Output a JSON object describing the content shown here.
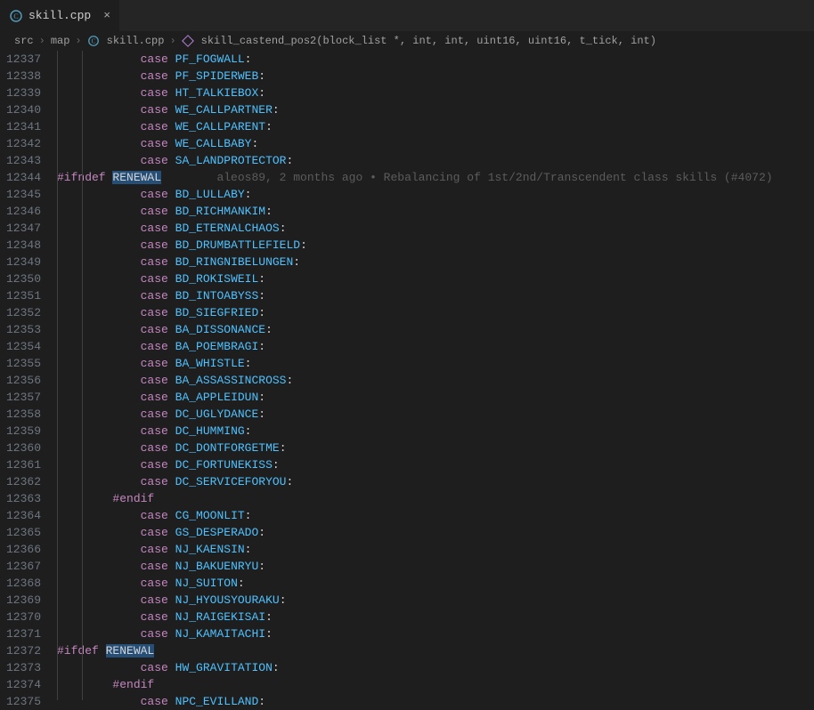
{
  "tab": {
    "filename": "skill.cpp",
    "close": "×"
  },
  "breadcrumb": {
    "seg1": "src",
    "seg2": "map",
    "seg3": "skill.cpp",
    "seg4": "skill_castend_pos2(block_list *, int, int, uint16, uint16, t_tick, int)"
  },
  "blame": {
    "author": "aleos89",
    "when": "2 months ago",
    "msg": "Rebalancing of 1st/2nd/Transcendent class skills (#4072)"
  },
  "chart_data": {
    "type": "table",
    "columns": [
      "lineNumber",
      "indent",
      "kind",
      "text",
      "highlight",
      "hasBlame"
    ],
    "rows": [
      {
        "ln": 12337,
        "indent": 3,
        "kind": "case",
        "text": "PF_FOGWALL"
      },
      {
        "ln": 12338,
        "indent": 3,
        "kind": "case",
        "text": "PF_SPIDERWEB"
      },
      {
        "ln": 12339,
        "indent": 3,
        "kind": "case",
        "text": "HT_TALKIEBOX"
      },
      {
        "ln": 12340,
        "indent": 3,
        "kind": "case",
        "text": "WE_CALLPARTNER"
      },
      {
        "ln": 12341,
        "indent": 3,
        "kind": "case",
        "text": "WE_CALLPARENT"
      },
      {
        "ln": 12342,
        "indent": 3,
        "kind": "case",
        "text": "WE_CALLBABY"
      },
      {
        "ln": 12343,
        "indent": 3,
        "kind": "case",
        "text": "SA_LANDPROTECTOR"
      },
      {
        "ln": 12344,
        "indent": 0,
        "kind": "ifndef",
        "text": "RENEWAL",
        "highlight": true,
        "hasBlame": true
      },
      {
        "ln": 12345,
        "indent": 3,
        "kind": "case",
        "text": "BD_LULLABY"
      },
      {
        "ln": 12346,
        "indent": 3,
        "kind": "case",
        "text": "BD_RICHMANKIM"
      },
      {
        "ln": 12347,
        "indent": 3,
        "kind": "case",
        "text": "BD_ETERNALCHAOS"
      },
      {
        "ln": 12348,
        "indent": 3,
        "kind": "case",
        "text": "BD_DRUMBATTLEFIELD"
      },
      {
        "ln": 12349,
        "indent": 3,
        "kind": "case",
        "text": "BD_RINGNIBELUNGEN"
      },
      {
        "ln": 12350,
        "indent": 3,
        "kind": "case",
        "text": "BD_ROKISWEIL"
      },
      {
        "ln": 12351,
        "indent": 3,
        "kind": "case",
        "text": "BD_INTOABYSS"
      },
      {
        "ln": 12352,
        "indent": 3,
        "kind": "case",
        "text": "BD_SIEGFRIED"
      },
      {
        "ln": 12353,
        "indent": 3,
        "kind": "case",
        "text": "BA_DISSONANCE"
      },
      {
        "ln": 12354,
        "indent": 3,
        "kind": "case",
        "text": "BA_POEMBRAGI"
      },
      {
        "ln": 12355,
        "indent": 3,
        "kind": "case",
        "text": "BA_WHISTLE"
      },
      {
        "ln": 12356,
        "indent": 3,
        "kind": "case",
        "text": "BA_ASSASSINCROSS"
      },
      {
        "ln": 12357,
        "indent": 3,
        "kind": "case",
        "text": "BA_APPLEIDUN"
      },
      {
        "ln": 12358,
        "indent": 3,
        "kind": "case",
        "text": "DC_UGLYDANCE"
      },
      {
        "ln": 12359,
        "indent": 3,
        "kind": "case",
        "text": "DC_HUMMING"
      },
      {
        "ln": 12360,
        "indent": 3,
        "kind": "case",
        "text": "DC_DONTFORGETME"
      },
      {
        "ln": 12361,
        "indent": 3,
        "kind": "case",
        "text": "DC_FORTUNEKISS"
      },
      {
        "ln": 12362,
        "indent": 3,
        "kind": "case",
        "text": "DC_SERVICEFORYOU"
      },
      {
        "ln": 12363,
        "indent": 2,
        "kind": "endif",
        "text": ""
      },
      {
        "ln": 12364,
        "indent": 3,
        "kind": "case",
        "text": "CG_MOONLIT"
      },
      {
        "ln": 12365,
        "indent": 3,
        "kind": "case",
        "text": "GS_DESPERADO"
      },
      {
        "ln": 12366,
        "indent": 3,
        "kind": "case",
        "text": "NJ_KAENSIN"
      },
      {
        "ln": 12367,
        "indent": 3,
        "kind": "case",
        "text": "NJ_BAKUENRYU"
      },
      {
        "ln": 12368,
        "indent": 3,
        "kind": "case",
        "text": "NJ_SUITON"
      },
      {
        "ln": 12369,
        "indent": 3,
        "kind": "case",
        "text": "NJ_HYOUSYOURAKU"
      },
      {
        "ln": 12370,
        "indent": 3,
        "kind": "case",
        "text": "NJ_RAIGEKISAI"
      },
      {
        "ln": 12371,
        "indent": 3,
        "kind": "case",
        "text": "NJ_KAMAITACHI"
      },
      {
        "ln": 12372,
        "indent": 0,
        "kind": "ifdef",
        "text": "RENEWAL",
        "highlight": true
      },
      {
        "ln": 12373,
        "indent": 3,
        "kind": "case",
        "text": "HW_GRAVITATION"
      },
      {
        "ln": 12374,
        "indent": 2,
        "kind": "endif",
        "text": ""
      },
      {
        "ln": 12375,
        "indent": 3,
        "kind": "case",
        "text": "NPC_EVILLAND"
      }
    ]
  }
}
